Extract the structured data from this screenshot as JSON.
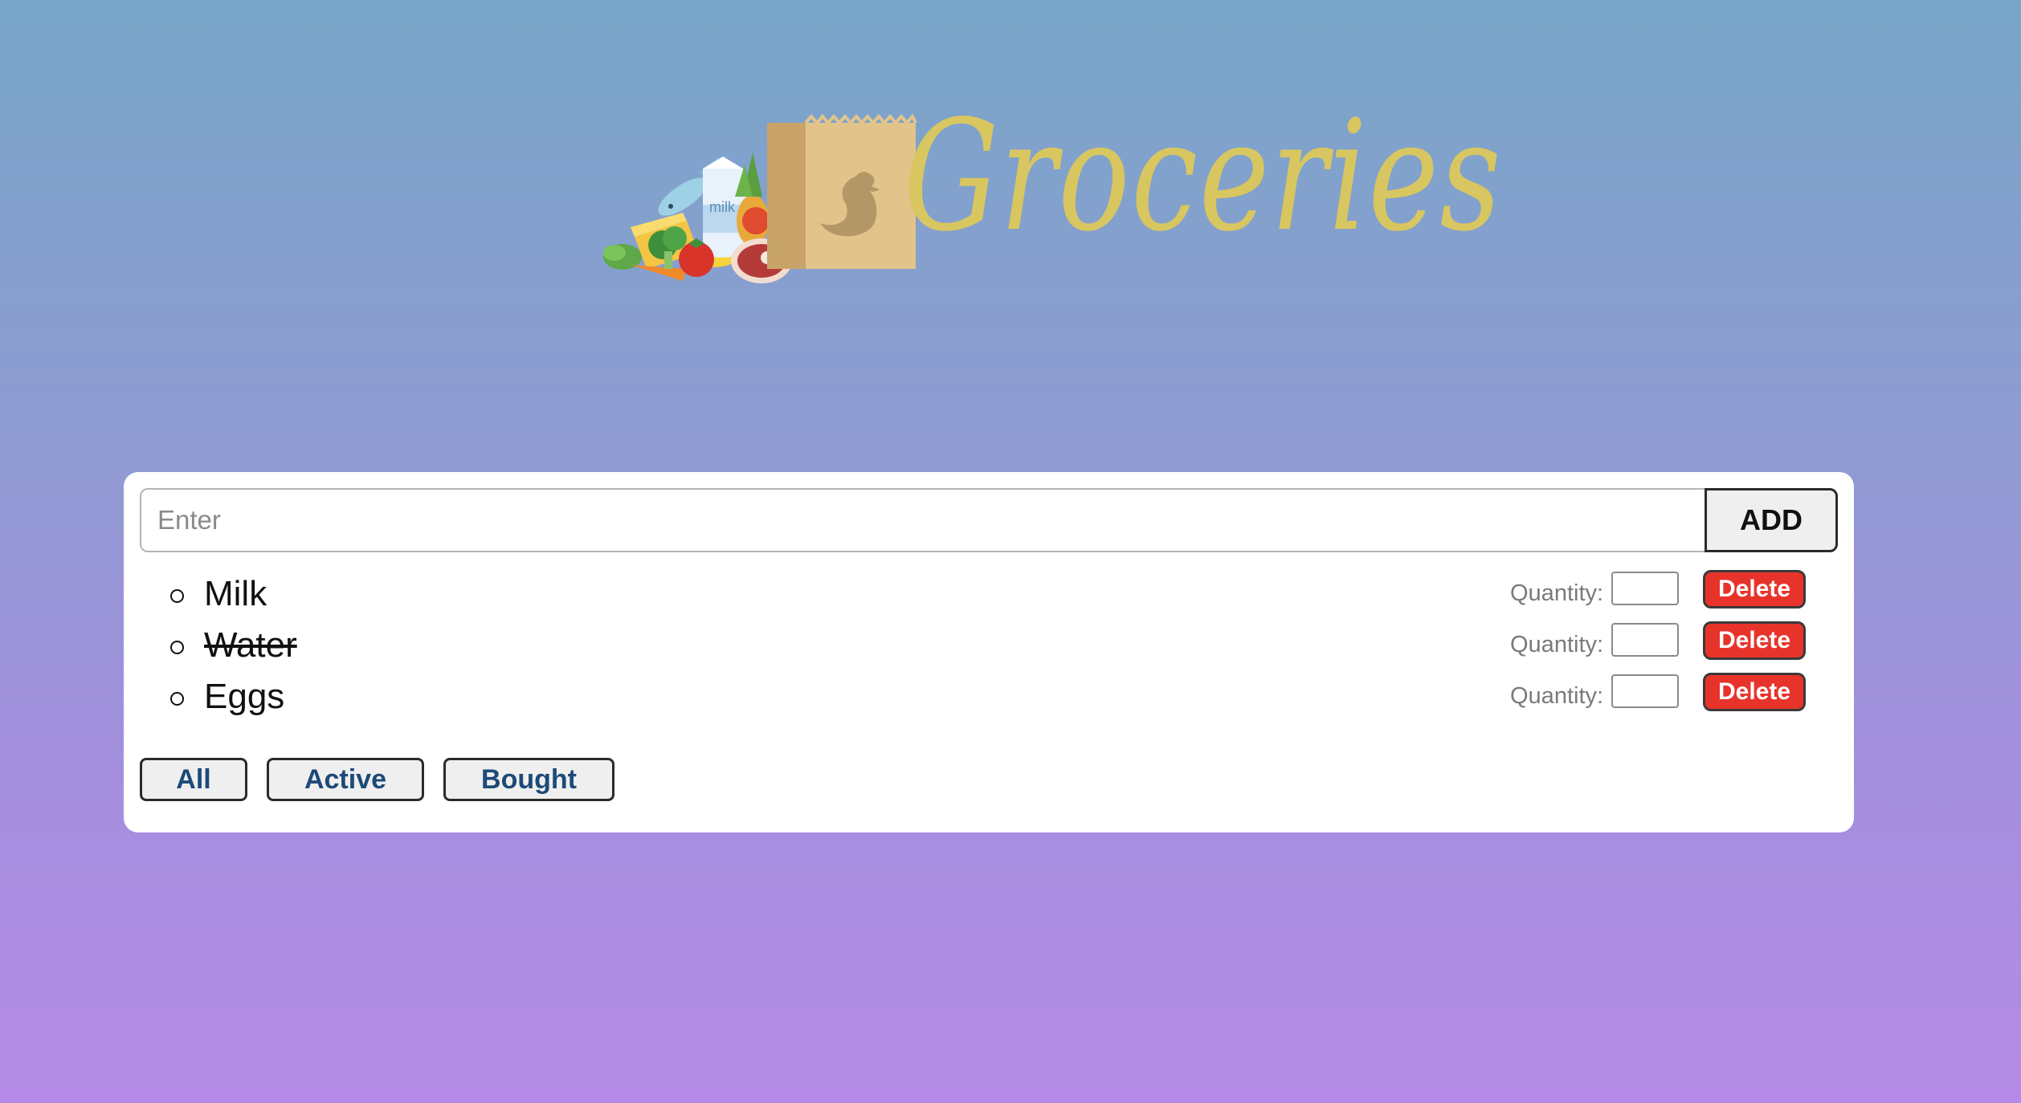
{
  "logo": {
    "text": "Groceries",
    "milk_label": "milk"
  },
  "entry": {
    "placeholder": "Enter",
    "value": "",
    "add_label": "ADD"
  },
  "items": [
    {
      "name": "Milk",
      "bought": false,
      "quantity_label": "Quantity:",
      "quantity": "",
      "delete_label": "Delete"
    },
    {
      "name": "Water",
      "bought": true,
      "quantity_label": "Quantity:",
      "quantity": "",
      "delete_label": "Delete"
    },
    {
      "name": "Eggs",
      "bought": false,
      "quantity_label": "Quantity:",
      "quantity": "",
      "delete_label": "Delete"
    }
  ],
  "filters": {
    "all_label": "All",
    "active_label": "Active",
    "bought_label": "Bought"
  },
  "colors": {
    "logo_text": "#d8c660",
    "delete": "#e8332b",
    "filter_text": "#1d4a78"
  }
}
